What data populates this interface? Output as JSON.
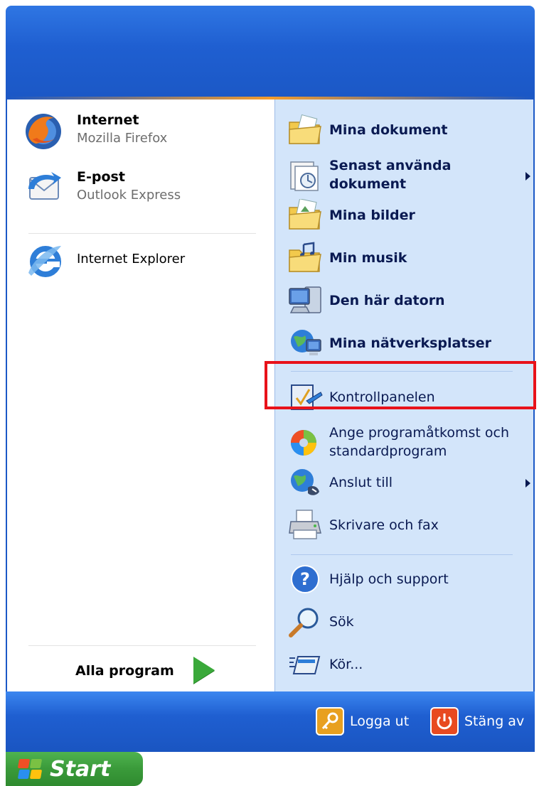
{
  "pinned": [
    {
      "title": "Internet",
      "subtitle": "Mozilla Firefox"
    },
    {
      "title": "E-post",
      "subtitle": "Outlook Express"
    }
  ],
  "recent": [
    {
      "label": "Internet Explorer"
    }
  ],
  "all_programs": "Alla program",
  "right_items": [
    {
      "label": "Mina dokument",
      "icon": "folder-documents-icon"
    },
    {
      "label": "Senast använda dokument",
      "icon": "recent-documents-icon"
    },
    {
      "label": "Mina bilder",
      "icon": "folder-pictures-icon"
    },
    {
      "label": "Min musik",
      "icon": "folder-music-icon"
    },
    {
      "label": "Den här datorn",
      "icon": "computer-icon"
    },
    {
      "label": "Mina nätverksplatser",
      "icon": "network-icon"
    },
    {
      "label": "Kontrollpanelen",
      "icon": "control-panel-icon"
    },
    {
      "label": "Ange programåtkomst och standardprogram",
      "icon": "program-access-icon"
    },
    {
      "label": "Anslut till",
      "icon": "connect-icon"
    },
    {
      "label": "Skrivare och fax",
      "icon": "printer-icon"
    },
    {
      "label": "Hjälp och support",
      "icon": "help-icon"
    },
    {
      "label": "Sök",
      "icon": "search-icon"
    },
    {
      "label": "Kör...",
      "icon": "run-icon"
    }
  ],
  "bottom": {
    "logout": "Logga ut",
    "shutdown": "Stäng av"
  },
  "taskbar": {
    "start_label": "Start"
  },
  "colors": {
    "highlight_border": "#e8121a",
    "right_pane_bg": "#d3e5fa",
    "bar_blue": "#1f5fd1"
  }
}
